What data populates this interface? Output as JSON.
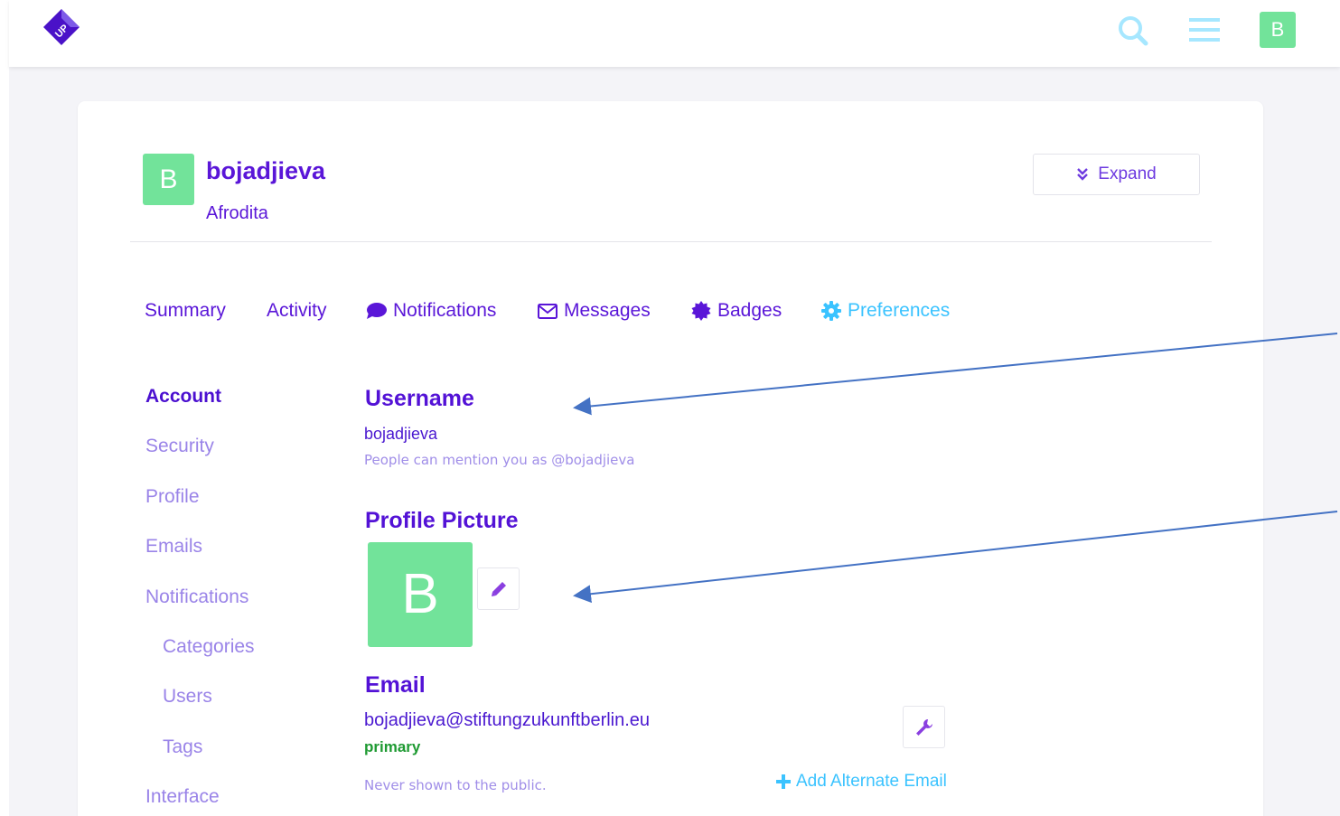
{
  "header": {
    "avatar_letter": "B",
    "accent_color": "#3bc3ff",
    "avatar_color": "#72e39a"
  },
  "user": {
    "avatar_letter": "B",
    "username": "bojadjieva",
    "full_name": "Afrodita"
  },
  "expand_button": {
    "label": "Expand"
  },
  "tabs": [
    {
      "label": "Summary",
      "icon": ""
    },
    {
      "label": "Activity",
      "icon": ""
    },
    {
      "label": "Notifications",
      "icon": "comment-icon"
    },
    {
      "label": "Messages",
      "icon": "envelope-icon"
    },
    {
      "label": "Badges",
      "icon": "certificate-icon"
    },
    {
      "label": "Preferences",
      "icon": "cog-icon",
      "active": true
    }
  ],
  "sidenav": [
    {
      "label": "Account",
      "active": true
    },
    {
      "label": "Security"
    },
    {
      "label": "Profile"
    },
    {
      "label": "Emails"
    },
    {
      "label": "Notifications"
    },
    {
      "label": "Categories"
    },
    {
      "label": "Users"
    },
    {
      "label": "Tags"
    },
    {
      "label": "Interface"
    }
  ],
  "username_section": {
    "title": "Username",
    "value": "bojadjieva",
    "hint": "People can mention you as @bojadjieva"
  },
  "picture_section": {
    "title": "Profile Picture",
    "avatar_letter": "B"
  },
  "email_section": {
    "title": "Email",
    "value": "bojadjieva@stiftungzukunftberlin.eu",
    "primary_label": "primary",
    "hint": "Never shown to the public.",
    "add_alternate": "Add Alternate Email"
  }
}
